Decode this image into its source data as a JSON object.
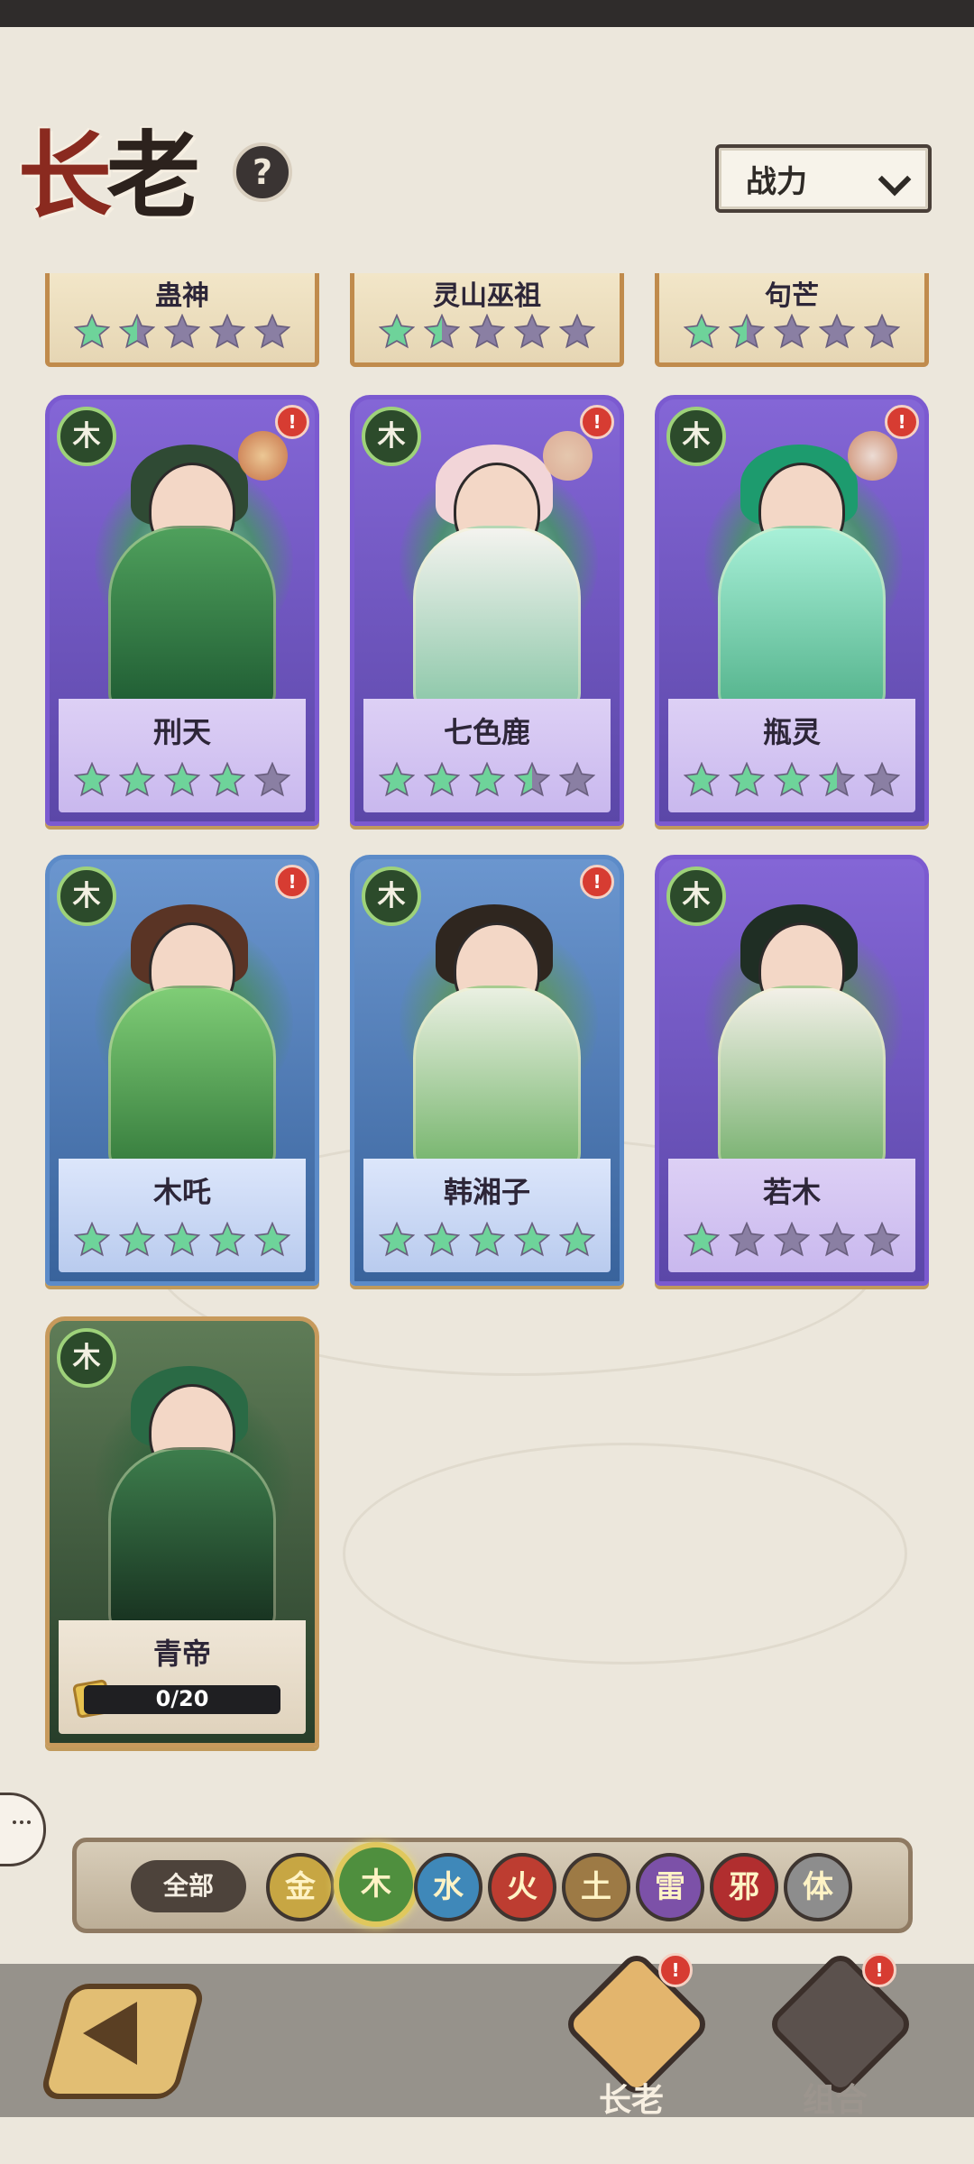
{
  "header": {
    "title_part1": "长",
    "title_part2": "老",
    "help_icon": "?",
    "sort_label": "战力"
  },
  "partial_cards": [
    {
      "name": "蛊神",
      "stars_filled": 1.5
    },
    {
      "name": "灵山巫祖",
      "stars_filled": 1.5
    },
    {
      "name": "句芒",
      "stars_filled": 1.5
    }
  ],
  "cards": [
    {
      "name": "刑天",
      "element": "木",
      "stars_filled": 4,
      "theme": "purple"
    },
    {
      "name": "七色鹿",
      "element": "木",
      "stars_filled": 3.5,
      "theme": "purple"
    },
    {
      "name": "瓶灵",
      "element": "木",
      "stars_filled": 3.5,
      "theme": "purple"
    },
    {
      "name": "木吒",
      "element": "木",
      "stars_filled": 5,
      "theme": "blue"
    },
    {
      "name": "韩湘子",
      "element": "木",
      "stars_filled": 5,
      "theme": "blue"
    },
    {
      "name": "若木",
      "element": "木",
      "stars_filled": 1,
      "theme": "purple"
    },
    {
      "name": "青帝",
      "element": "木",
      "progress_text": "0/20",
      "progress": 0.0,
      "theme": "gold"
    }
  ],
  "filter": {
    "all_label": "全部",
    "elements": [
      {
        "label": "金",
        "color": "#c7a643"
      },
      {
        "label": "木",
        "color": "#4f8f3e"
      },
      {
        "label": "水",
        "color": "#3f88b9"
      },
      {
        "label": "火",
        "color": "#bd3d31"
      },
      {
        "label": "土",
        "color": "#9d7a45"
      },
      {
        "label": "雷",
        "color": "#7c51a8"
      },
      {
        "label": "邪",
        "color": "#b12e2f"
      },
      {
        "label": "体",
        "color": "#8d8d8d"
      }
    ],
    "active": "木"
  },
  "bottom_nav": {
    "tab1": "长老",
    "tab2": "组合"
  },
  "colors": {
    "star_filled": "#6ed39a",
    "star_empty": "#8a7fa3"
  }
}
